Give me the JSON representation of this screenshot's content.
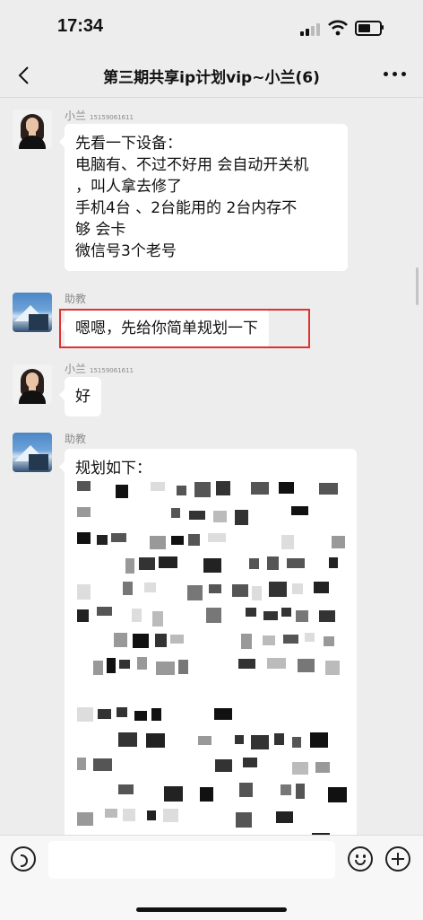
{
  "status_bar": {
    "time": "17:34"
  },
  "nav": {
    "title": "第三期共享ip计划vip~小兰(6)"
  },
  "messages": [
    {
      "sender": "小兰",
      "sender_phone": "15159061611",
      "lines": [
        "先看一下设备：",
        "电脑有、不过不好用 会自动开关机",
        "，叫人拿去修了",
        "手机4台 、2台能用的 2台内存不",
        "够 会卡",
        "微信号3个老号"
      ]
    },
    {
      "sender": "助教",
      "lines": [
        "嗯嗯，先给你简单规划一下"
      ]
    },
    {
      "sender": "小兰",
      "sender_phone": "15159061611",
      "lines": [
        "好"
      ]
    },
    {
      "sender": "助教",
      "lines": [
        "规划如下："
      ]
    }
  ],
  "colors": {
    "highlight": "#e03030",
    "bubble": "#ffffff",
    "background": "#ededed"
  },
  "icons": {
    "back": "chevron-left-icon",
    "more": "more-icon",
    "voice": "voice-icon",
    "emoji": "emoji-icon",
    "plus": "plus-icon"
  }
}
